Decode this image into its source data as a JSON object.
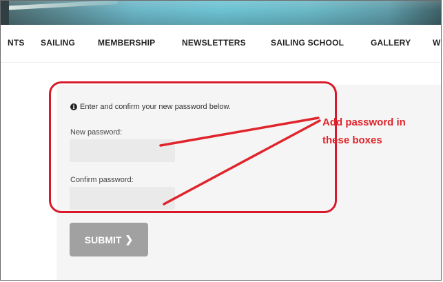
{
  "nav": {
    "items": [
      "NTS",
      "SAILING",
      "MEMBERSHIP",
      "NEWSLETTERS",
      "SAILING SCHOOL",
      "GALLERY",
      "W"
    ]
  },
  "form": {
    "info_icon": "info-icon",
    "info_text": "Enter and confirm your new password below.",
    "new_password_label": "New password:",
    "new_password_value": "",
    "confirm_password_label": "Confirm password:",
    "confirm_password_value": "",
    "submit_label": "SUBMIT",
    "submit_icon": "chevron-right-icon"
  },
  "annotation": {
    "line1": "Add password in",
    "line2": "these boxes",
    "color": "#e0242b"
  },
  "colors": {
    "banner": "#6cc2d2",
    "submit_bg": "#a1a1a1",
    "field_bg": "#eaeaea",
    "panel_bg": "#f5f5f5"
  }
}
